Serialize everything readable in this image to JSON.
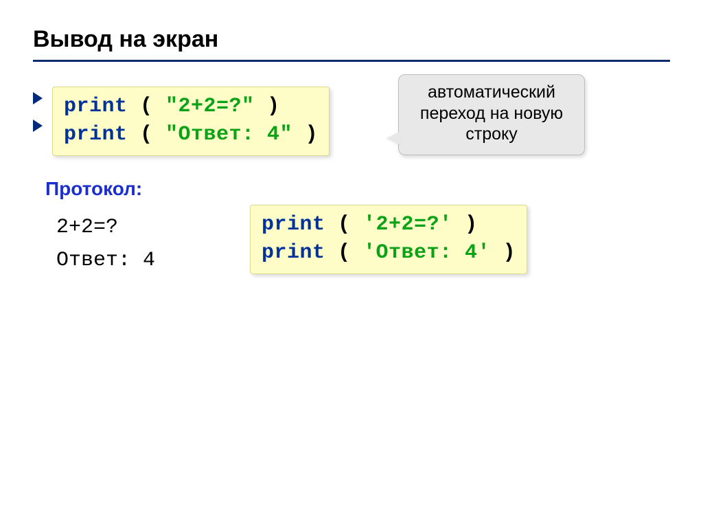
{
  "title": "Вывод на экран",
  "code1": {
    "line1": {
      "kw": "print",
      "open": " ( ",
      "str": "\"2+2=?\"",
      "close": " )"
    },
    "line2": {
      "kw": "print",
      "open": " ( ",
      "str": "\"Ответ: 4\"",
      "close": " )"
    }
  },
  "callout": "автоматический переход на новую строку",
  "protocolLabel": "Протокол:",
  "output": {
    "line1": "2+2=?",
    "line2": "Ответ: 4"
  },
  "code2": {
    "line1": {
      "kw": "print",
      "open": " ( ",
      "str": "'2+2=?'",
      "close": " )"
    },
    "line2": {
      "kw": "print",
      "open": " ( ",
      "str": "'Ответ: 4'",
      "close": " )"
    }
  }
}
